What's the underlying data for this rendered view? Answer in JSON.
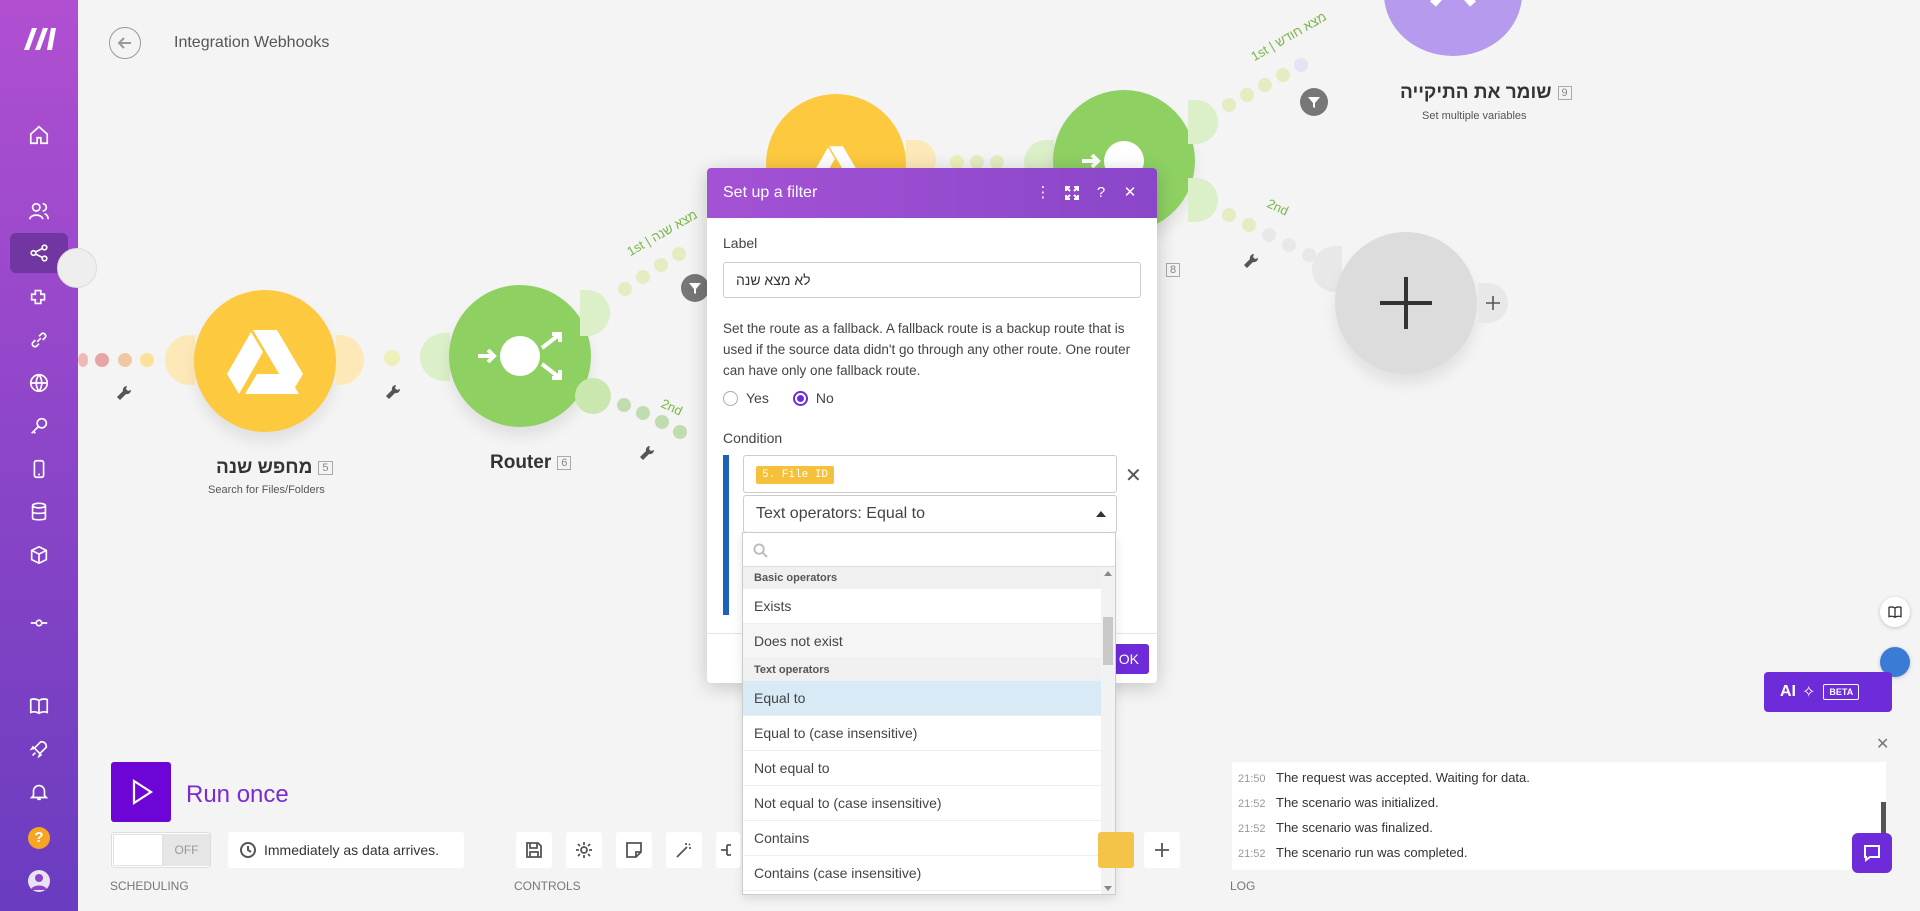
{
  "app": {
    "scenario_title": "Integration Webhooks"
  },
  "colors": {
    "sidebar_top": "#b14fd1",
    "sidebar_bottom": "#6a3cc0",
    "accent": "#6d2bd9",
    "google_drive": "#fdc93f",
    "router": "#8ed162",
    "tools": "#b69aee"
  },
  "nodes": {
    "search": {
      "label": "מחפש שנה",
      "num": "5",
      "sub": "Search for Files/Folders"
    },
    "router": {
      "label": "Router",
      "num": "6"
    },
    "set_vars": {
      "label": "שומר את התיקייה",
      "num": "9",
      "sub": "Set multiple variables"
    },
    "hidden_num": "8"
  },
  "routes": {
    "upper_first": "1st",
    "upper_first_name": "מצא שנה",
    "lower_second": "2nd",
    "top_first": "1st",
    "top_first_name": "מצא חודש",
    "right_second": "2nd"
  },
  "dialog": {
    "title": "Set up a filter",
    "label_field_title": "Label",
    "label_value": "לא מצא שנה",
    "fallback_text": "Set the route as a fallback. A fallback route is a backup route that is used if the source data didn't go through any other route. One router can have only one fallback route.",
    "radio_yes": "Yes",
    "radio_no": "No",
    "condition_title": "Condition",
    "condition_pill": "5. File ID",
    "operator_value": "Text operators: Equal to",
    "ok_label": "OK"
  },
  "dropdown": {
    "groups": [
      {
        "title": "Basic operators",
        "items": [
          "Exists",
          "Does not exist"
        ]
      },
      {
        "title": "Text operators",
        "items": [
          "Equal to",
          "Equal to (case insensitive)",
          "Not equal to",
          "Not equal to (case insensitive)",
          "Contains",
          "Contains (case insensitive)"
        ]
      }
    ],
    "selected": "Equal to"
  },
  "toolbar": {
    "run_label": "Run once",
    "toggle_state": "OFF",
    "schedule_text": "Immediately as data arrives.",
    "section_scheduling": "SCHEDULING",
    "section_controls": "CONTROLS",
    "section_log": "LOG"
  },
  "log": {
    "entries": [
      {
        "time": "21:50",
        "text": "The request was accepted. Waiting for data."
      },
      {
        "time": "21:52",
        "text": "The scenario was initialized."
      },
      {
        "time": "21:52",
        "text": "The scenario was finalized."
      },
      {
        "time": "21:52",
        "text": "The scenario run was completed."
      }
    ]
  },
  "ai_button": {
    "label": "AI",
    "badge": "BETA"
  }
}
